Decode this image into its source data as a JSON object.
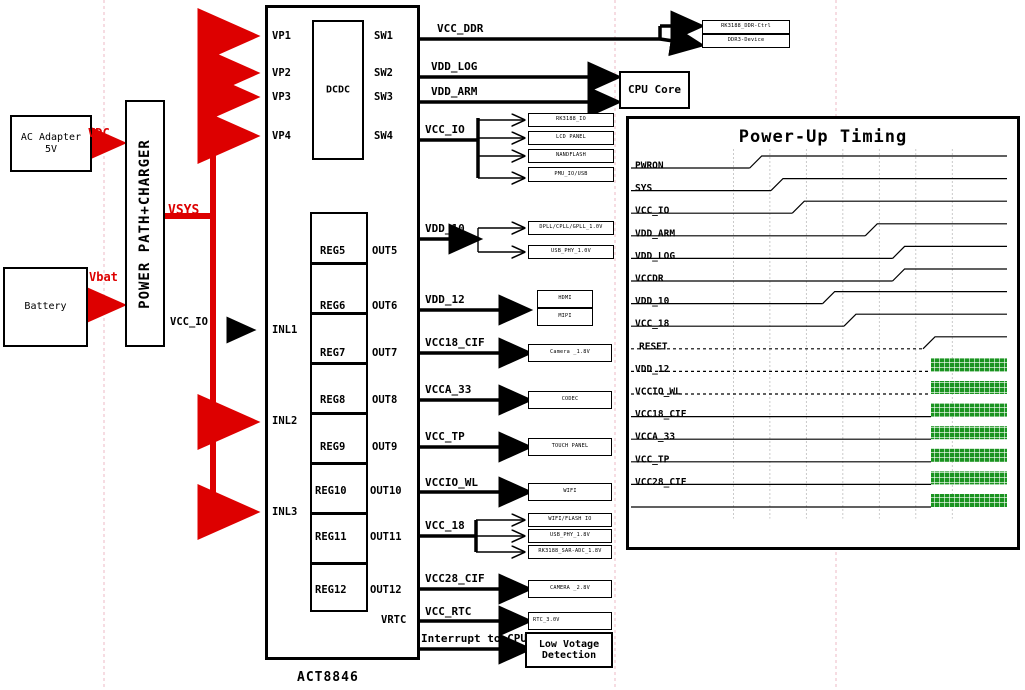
{
  "meta": {
    "chip_label": "ACT8846",
    "colors": {
      "red": "#dd0000",
      "green": "#1a9420",
      "black": "#000000",
      "pink_guide": "#e8a8b8"
    }
  },
  "sources": {
    "ac_adapter": {
      "line1": "AC Adapter",
      "line2": "5V"
    },
    "battery": {
      "label": "Battery"
    },
    "power_path": {
      "label": "POWER PATH+CHARGER"
    },
    "rails": {
      "vdc": "VDC",
      "vbat": "Vbat",
      "vsys": "VSYS",
      "vcc_io_in": "VCC_IO"
    }
  },
  "pmic": {
    "name": "ACT8846",
    "dcdc_label": "DCDC",
    "dcdc_inputs": [
      "VP1",
      "VP2",
      "VP3",
      "VP4"
    ],
    "dcdc_outputs": [
      "SW1",
      "SW2",
      "SW3",
      "SW4"
    ],
    "ldo_inputs": [
      "INL1",
      "INL2",
      "INL3"
    ],
    "regulators": [
      "REG5",
      "REG6",
      "REG7",
      "REG8",
      "REG9",
      "REG10",
      "REG11",
      "REG12"
    ],
    "ldo_outputs": [
      "OUT5",
      "OUT6",
      "OUT7",
      "OUT8",
      "OUT9",
      "OUT10",
      "OUT11",
      "OUT12"
    ],
    "vrtc_label": "VRTC"
  },
  "nets": [
    {
      "name": "VCC_DDR"
    },
    {
      "name": "VDD_LOG"
    },
    {
      "name": "VDD_ARM"
    },
    {
      "name": "VCC_IO"
    },
    {
      "name": "VDD_10"
    },
    {
      "name": "VDD_12"
    },
    {
      "name": "VCC18_CIF"
    },
    {
      "name": "VCCA_33"
    },
    {
      "name": "VCC_TP"
    },
    {
      "name": "VCCIO_WL"
    },
    {
      "name": "VCC_18"
    },
    {
      "name": "VCC28_CIF"
    },
    {
      "name": "VCC_RTC"
    },
    {
      "name": "Interrupt to CPU"
    }
  ],
  "loads": {
    "ddr": [
      "RK3188_DDR-Ctrl",
      "DDR3-Device"
    ],
    "cpu_core": "CPU Core",
    "vcc_io_group": [
      "RK3188_IO",
      "LCD PANEL",
      "NANDFLASH",
      "PMU_IO/USB"
    ],
    "vdd_10_group": [
      "DPLL/CPLL/GPLL_1.0V",
      "USB_PHY_1.0V"
    ],
    "vdd_12_group": [
      "HDMI",
      "MIPI"
    ],
    "vcc18_cif_group": [
      "Camera _1.8V"
    ],
    "vcca_33_group": [
      "CODEC"
    ],
    "vcc_tp_group": [
      "TOUCH PANEL"
    ],
    "vccio_wl_group": [
      "WIFI"
    ],
    "vcc_18_group": [
      "WIFI/FLASH IO",
      "USB_PHY_1.8V",
      "RK3188_SAR-ADC_1.8V"
    ],
    "vcc28_cif_group": [
      "CAMERA _2.8V"
    ],
    "vcc_rtc_group": [
      "RTC_3.0V"
    ],
    "lvd": {
      "line1": "Low Votage",
      "line2": "Detection"
    }
  },
  "timing": {
    "title": "Power-Up Timing",
    "ramp_signals": [
      {
        "label": "PWRON",
        "rise_pct": 18
      },
      {
        "label": "SYS",
        "rise_pct": 25
      },
      {
        "label": "VCC_IO",
        "rise_pct": 32
      },
      {
        "label": "VDD_ARM",
        "rise_pct": 56
      },
      {
        "label": "VDD_LOG",
        "rise_pct": 65
      },
      {
        "label": "VCCDR",
        "rise_pct": 65
      },
      {
        "label": "VDD_10",
        "rise_pct": 42
      },
      {
        "label": "VCC_18",
        "rise_pct": 49
      },
      {
        "label": "RESET",
        "rise_pct": 75,
        "dashed_low": true
      }
    ],
    "hatched_signals": [
      {
        "label": "VDD_12",
        "start_pct": 75,
        "dashed_low": true
      },
      {
        "label": "VCCIO_WL",
        "start_pct": 75,
        "dashed_low": true
      },
      {
        "label": "VCC18_CIF",
        "start_pct": 75
      },
      {
        "label": "VCCA_33",
        "start_pct": 75
      },
      {
        "label": "VCC_TP",
        "start_pct": 75
      },
      {
        "label": "VCC28_CIF",
        "start_pct": 75
      },
      {
        "label": "",
        "start_pct": 75
      }
    ]
  }
}
